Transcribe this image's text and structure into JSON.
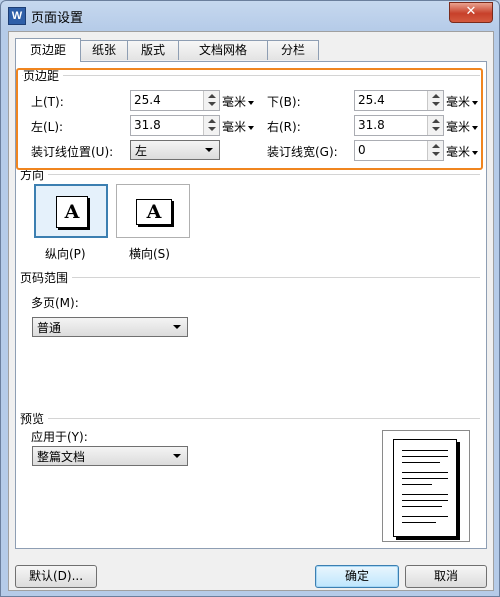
{
  "window": {
    "title": "页面设置",
    "app_icon": "W",
    "close": "✕"
  },
  "tabs": [
    "页边距",
    "纸张",
    "版式",
    "文档网格",
    "分栏"
  ],
  "margins": {
    "section_title": "页边距",
    "top_label": "上(T):",
    "top_value": "25.4",
    "bottom_label": "下(B):",
    "bottom_value": "25.4",
    "left_label": "左(L):",
    "left_value": "31.8",
    "right_label": "右(R):",
    "right_value": "31.8",
    "unit": "毫米",
    "gutter_pos_label": "装订线位置(U):",
    "gutter_pos_value": "左",
    "gutter_width_label": "装订线宽(G):",
    "gutter_width_value": "0"
  },
  "orientation": {
    "section_title": "方向",
    "portrait_label": "纵向(P)",
    "landscape_label": "横向(S)",
    "glyph": "A"
  },
  "pages": {
    "section_title": "页码范围",
    "multi_label": "多页(M):",
    "multi_value": "普通"
  },
  "preview": {
    "section_title": "预览",
    "apply_label": "应用于(Y):",
    "apply_value": "整篇文档"
  },
  "buttons": {
    "default": "默认(D)...",
    "ok": "确定",
    "cancel": "取消"
  }
}
